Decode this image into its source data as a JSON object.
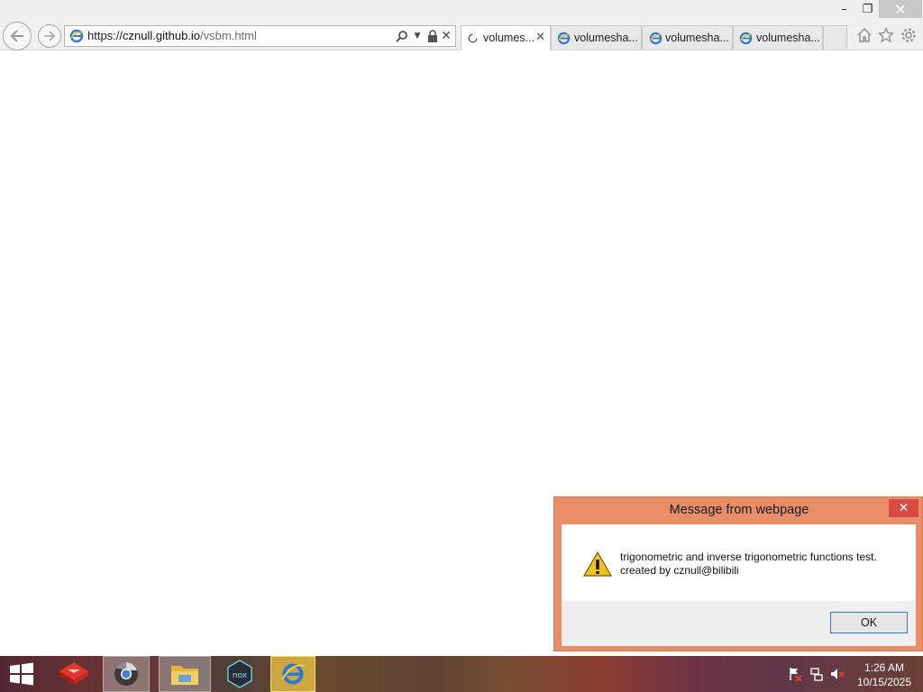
{
  "window": {
    "minimize_glyph": "–",
    "restore_glyph": "❐",
    "close_glyph": "✕"
  },
  "address": {
    "prefix": "https://",
    "host": "cznull.github.io",
    "path": "/vsbm.html"
  },
  "tabs": [
    {
      "label": "volumes...",
      "active": true,
      "icon": "loading-spinner-icon"
    },
    {
      "label": "volumesha...",
      "active": false,
      "icon": "ie-page-icon"
    },
    {
      "label": "volumesha...",
      "active": false,
      "icon": "ie-page-icon"
    },
    {
      "label": "volumesha...",
      "active": false,
      "icon": "ie-page-icon"
    }
  ],
  "toolbar_icons": [
    "home-icon",
    "favorites-star-icon",
    "settings-gear-icon"
  ],
  "dialog": {
    "title": "Message from webpage",
    "message_line1": "trigonometric and inverse trigonometric functions test.",
    "message_line2": "created by cznull@bilibili",
    "ok_label": "OK",
    "icon": "warning-icon"
  },
  "taskbar": {
    "apps": [
      "start-windows-icon",
      "pinned-app-icon",
      "chrome-icon",
      "file-explorer-icon",
      "nox-icon",
      "internet-explorer-icon"
    ],
    "nox_label": "nox",
    "tray_icons": [
      "action-center-flag-icon",
      "network-icon",
      "volume-muted-icon"
    ],
    "time": "1:26 AM",
    "date": "10/15/2025"
  },
  "colors": {
    "dialog_frame": "#e98e67",
    "dialog_close": "#d94a45",
    "ok_border": "#3b7ac9",
    "ie_active": "#f0c846"
  }
}
